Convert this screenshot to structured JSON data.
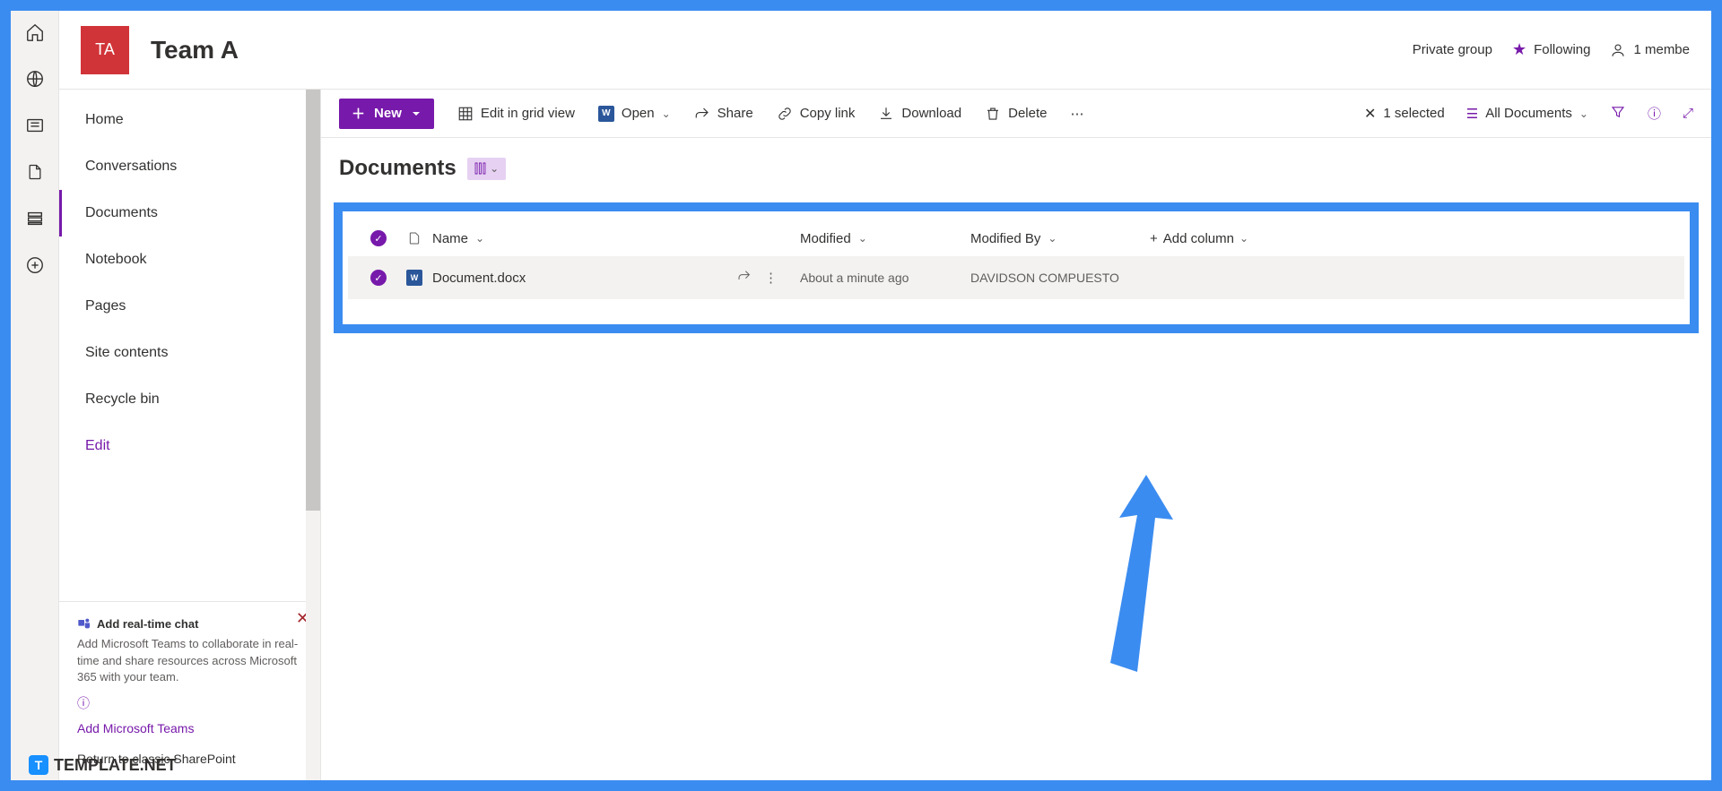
{
  "header": {
    "logo_text": "TA",
    "title": "Team A",
    "privacy": "Private group",
    "following": "Following",
    "members": "1 membe"
  },
  "nav": {
    "items": [
      "Home",
      "Conversations",
      "Documents",
      "Notebook",
      "Pages",
      "Site contents",
      "Recycle bin",
      "Edit"
    ]
  },
  "promo": {
    "title": "Add real-time chat",
    "desc": "Add Microsoft Teams to collaborate in real-time and share resources across Microsoft 365 with your team.",
    "link": "Add Microsoft Teams",
    "classic": "Return to classic SharePoint"
  },
  "cmd": {
    "new": "New",
    "edit_grid": "Edit in grid view",
    "open": "Open",
    "share": "Share",
    "copy": "Copy link",
    "download": "Download",
    "delete": "Delete",
    "selected": "1 selected",
    "view": "All Documents"
  },
  "docs": {
    "title": "Documents",
    "cols": {
      "name": "Name",
      "modified": "Modified",
      "modified_by": "Modified By",
      "add": "Add column"
    },
    "rows": [
      {
        "name": "Document.docx",
        "modified": "About a minute ago",
        "modified_by": "DAVIDSON COMPUESTO"
      }
    ]
  },
  "watermark": "TEMPLATE.NET"
}
